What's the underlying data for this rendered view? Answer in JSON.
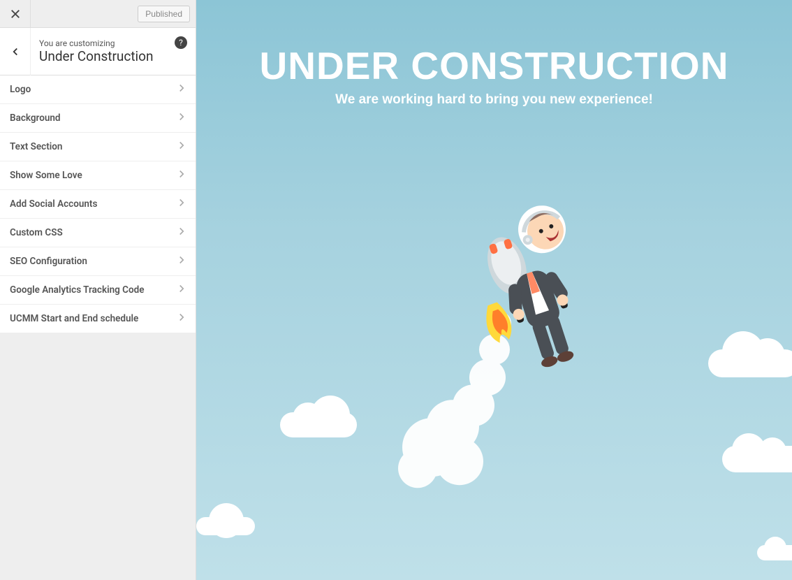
{
  "topbar": {
    "publish_label": "Published"
  },
  "header": {
    "customizing_label": "You are customizing",
    "panel_title": "Under Construction",
    "help_symbol": "?"
  },
  "menu": {
    "items": [
      {
        "label": "Logo"
      },
      {
        "label": "Background"
      },
      {
        "label": "Text Section"
      },
      {
        "label": "Show Some Love"
      },
      {
        "label": "Add Social Accounts"
      },
      {
        "label": "Custom CSS"
      },
      {
        "label": "SEO Configuration"
      },
      {
        "label": "Google Analytics Tracking Code"
      },
      {
        "label": "UCMM Start and End schedule"
      }
    ]
  },
  "preview": {
    "title": "UNDER CONSTRUCTION",
    "subtitle": "We are working hard to bring you new experience!"
  }
}
